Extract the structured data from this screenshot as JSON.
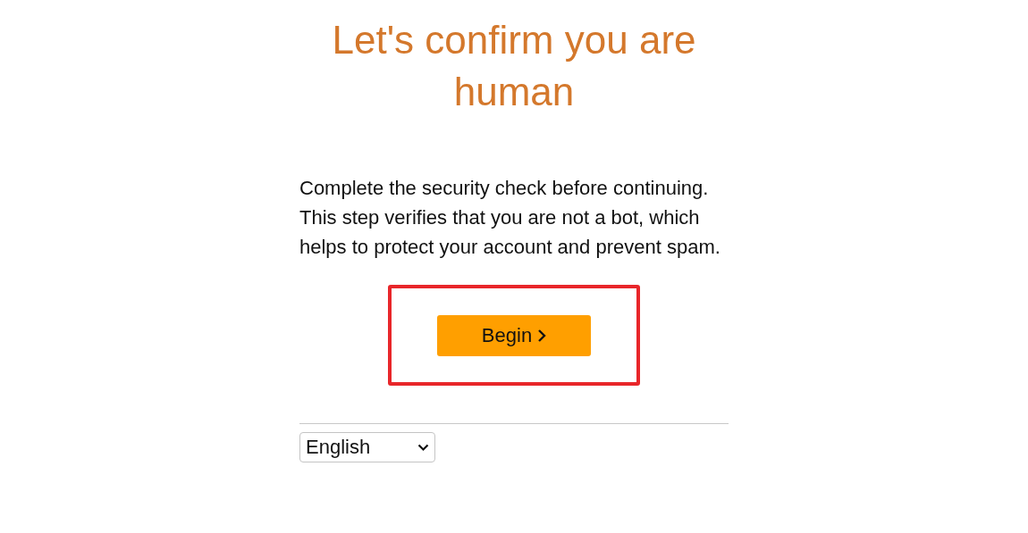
{
  "title": "Let's confirm you are human",
  "message": "Complete the security check before continuing. This step verifies that you are not a bot, which helps to protect your account and prevent spam.",
  "begin_button": {
    "label": "Begin",
    "highlighted": true
  },
  "language_select": {
    "value": "English"
  }
}
